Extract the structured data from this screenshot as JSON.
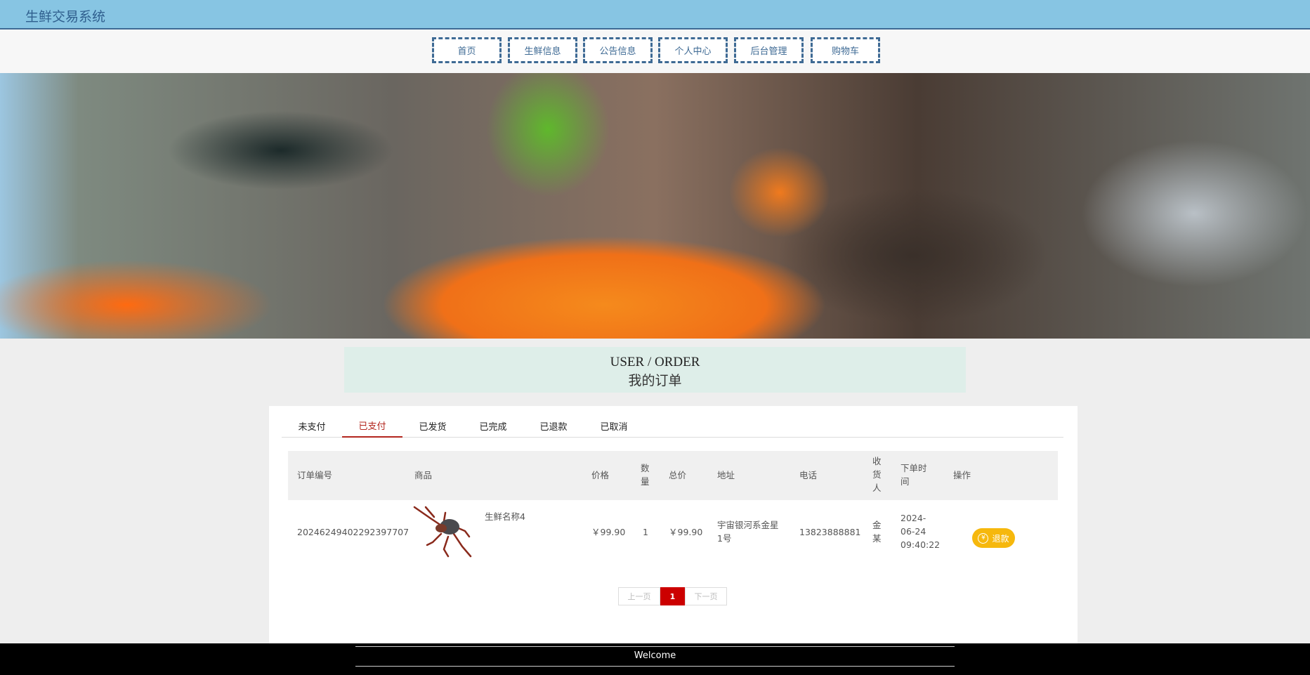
{
  "header": {
    "title": "生鲜交易系统"
  },
  "nav": [
    "首页",
    "生鲜信息",
    "公告信息",
    "个人中心",
    "后台管理",
    "购物车"
  ],
  "banner": {
    "slides": 3,
    "active_slide": 2
  },
  "section": {
    "title_en": "USER / ORDER",
    "title_cn": "我的订单"
  },
  "tabs": {
    "items": [
      "未支付",
      "已支付",
      "已发货",
      "已完成",
      "已退款",
      "已取消"
    ],
    "active": "已支付"
  },
  "table": {
    "headers": [
      "订单编号",
      "商品",
      "价格",
      "数量",
      "总价",
      "地址",
      "电话",
      "收货人",
      "下单时间",
      "操作"
    ],
    "rows": [
      {
        "order_no": "20246249402292397707",
        "product": "生鲜名称4",
        "price": "￥99.90",
        "qty": "1",
        "total": "￥99.90",
        "address": "宇宙银河系金星1号",
        "phone": "13823888881",
        "receiver": "金某",
        "time": "2024-06-24 09:40:22",
        "action": "退款",
        "action_icon": "yen-icon"
      }
    ]
  },
  "pagination": {
    "prev": "上一页",
    "current": "1",
    "next": "下一页"
  },
  "footer": {
    "text": "Welcome"
  },
  "colors": {
    "header": "#87c5e3",
    "accent": "#b3261e",
    "refund": "#f6b80d"
  }
}
